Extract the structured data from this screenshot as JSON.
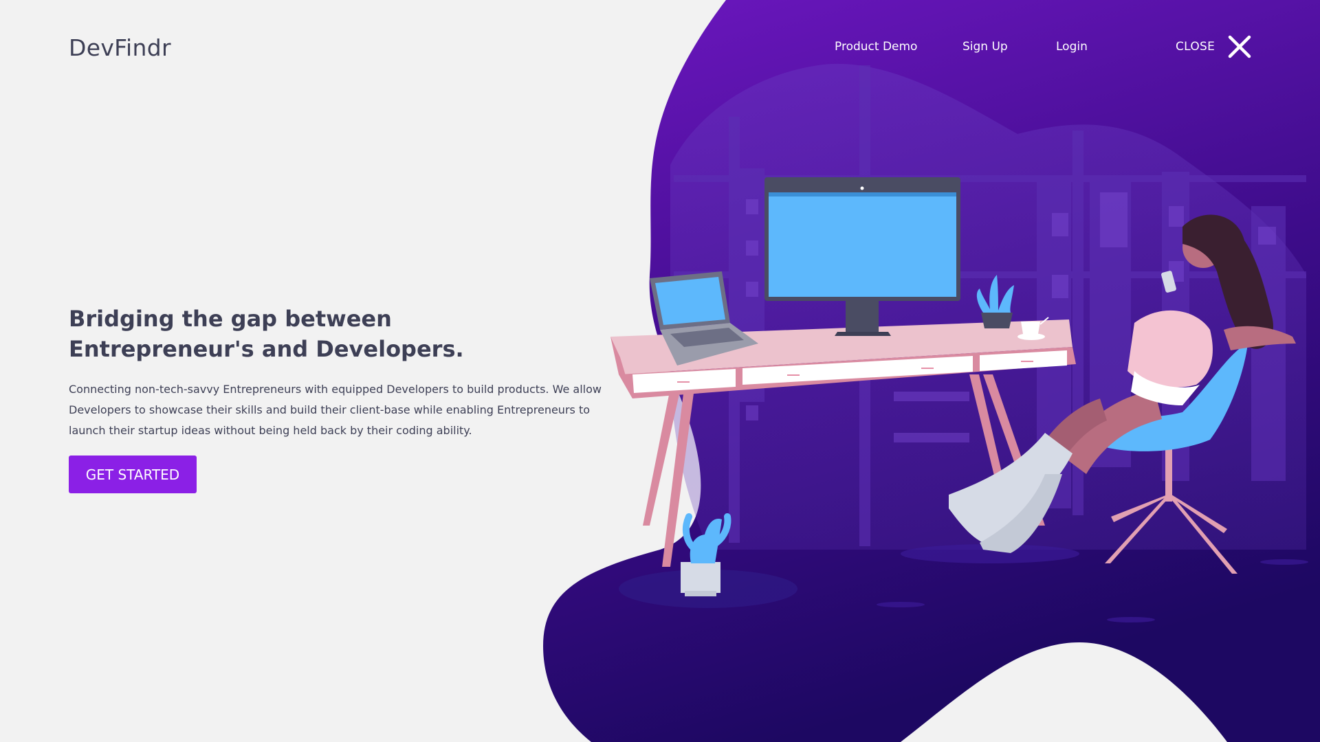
{
  "brand": {
    "name": "DevFindr"
  },
  "nav": {
    "product_demo": "Product Demo",
    "sign_up": "Sign Up",
    "login": "Login",
    "close_label": "CLOSE",
    "close_icon": "close-icon"
  },
  "hero": {
    "headline_line1": "Bridging the gap between",
    "headline_line2": "Entrepreneur's and Developers.",
    "description_line1": "Connecting non-tech-savvy Entrepreneurs with equipped Developers to  build  products. We allow",
    "description_line2": "Developers to showcase their skills and build their client-base while enabling Entrepreneurs to",
    "description_line3": "launch their startup ideas without being held back  by their coding ability.",
    "cta_label": "GET STARTED"
  },
  "colors": {
    "background": "#f2f2f2",
    "text_dark": "#3d3f55",
    "accent": "#8b20e6",
    "blob_top": "#6a16b8",
    "blob_bottom": "#240a6e",
    "screen_blue": "#5db8fc",
    "desk_pink": "#e9b8c3"
  }
}
